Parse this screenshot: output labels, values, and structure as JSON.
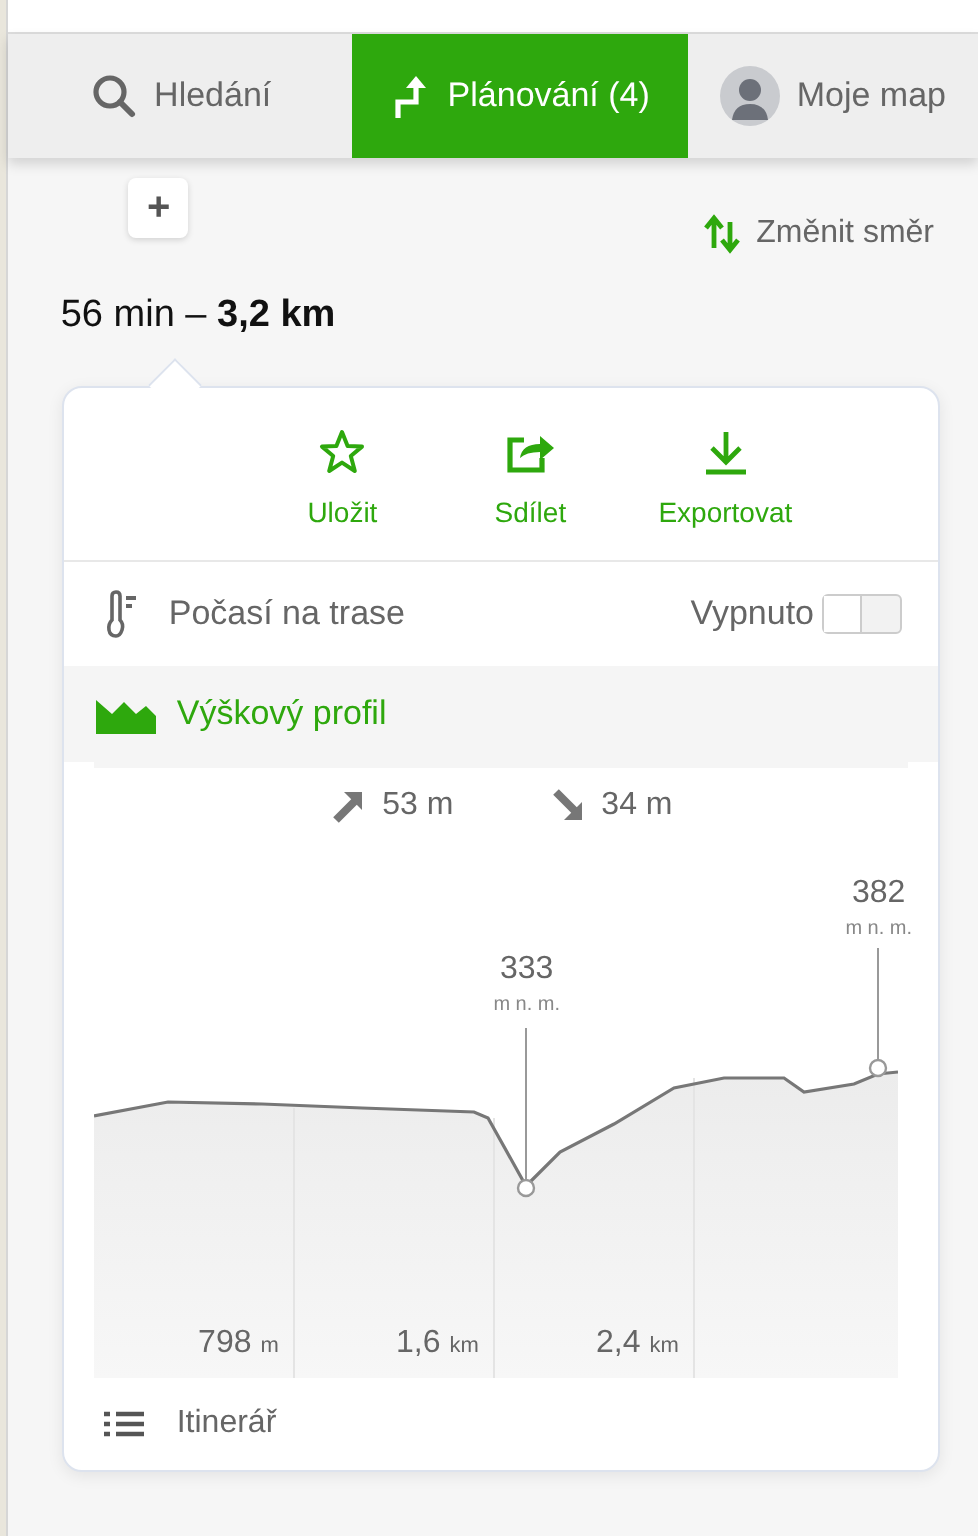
{
  "tabs": [
    {
      "kind": "search",
      "label": "Hledání",
      "selected": false
    },
    {
      "kind": "route",
      "label": "Plánování (4)",
      "selected": true
    },
    {
      "kind": "user",
      "label": "Moje map",
      "selected": false
    }
  ],
  "add_button": "+",
  "reverse": "Změnit směr",
  "summary": "56 min – **3,2 km**",
  "actions": [
    {
      "kind": "star",
      "label": "Uložit"
    },
    {
      "kind": "share",
      "label": "Sdílet"
    },
    {
      "kind": "download",
      "label": "Exportovat"
    }
  ],
  "weather": {
    "label": "Počasí na trase",
    "state": "Vypnuto",
    "on": false
  },
  "profile": {
    "title": "Výškový profil",
    "ascent": "53 m",
    "descent": "34 m",
    "low": {
      "value": "333",
      "unit": "m n. m."
    },
    "high": {
      "value": "382",
      "unit": "m n. m."
    },
    "distances": [
      {
        "value": "798",
        "unit": "m"
      },
      {
        "value": "1,6",
        "unit": "km"
      },
      {
        "value": "2,4",
        "unit": "km"
      }
    ]
  },
  "itinerary": "Itinerář"
}
